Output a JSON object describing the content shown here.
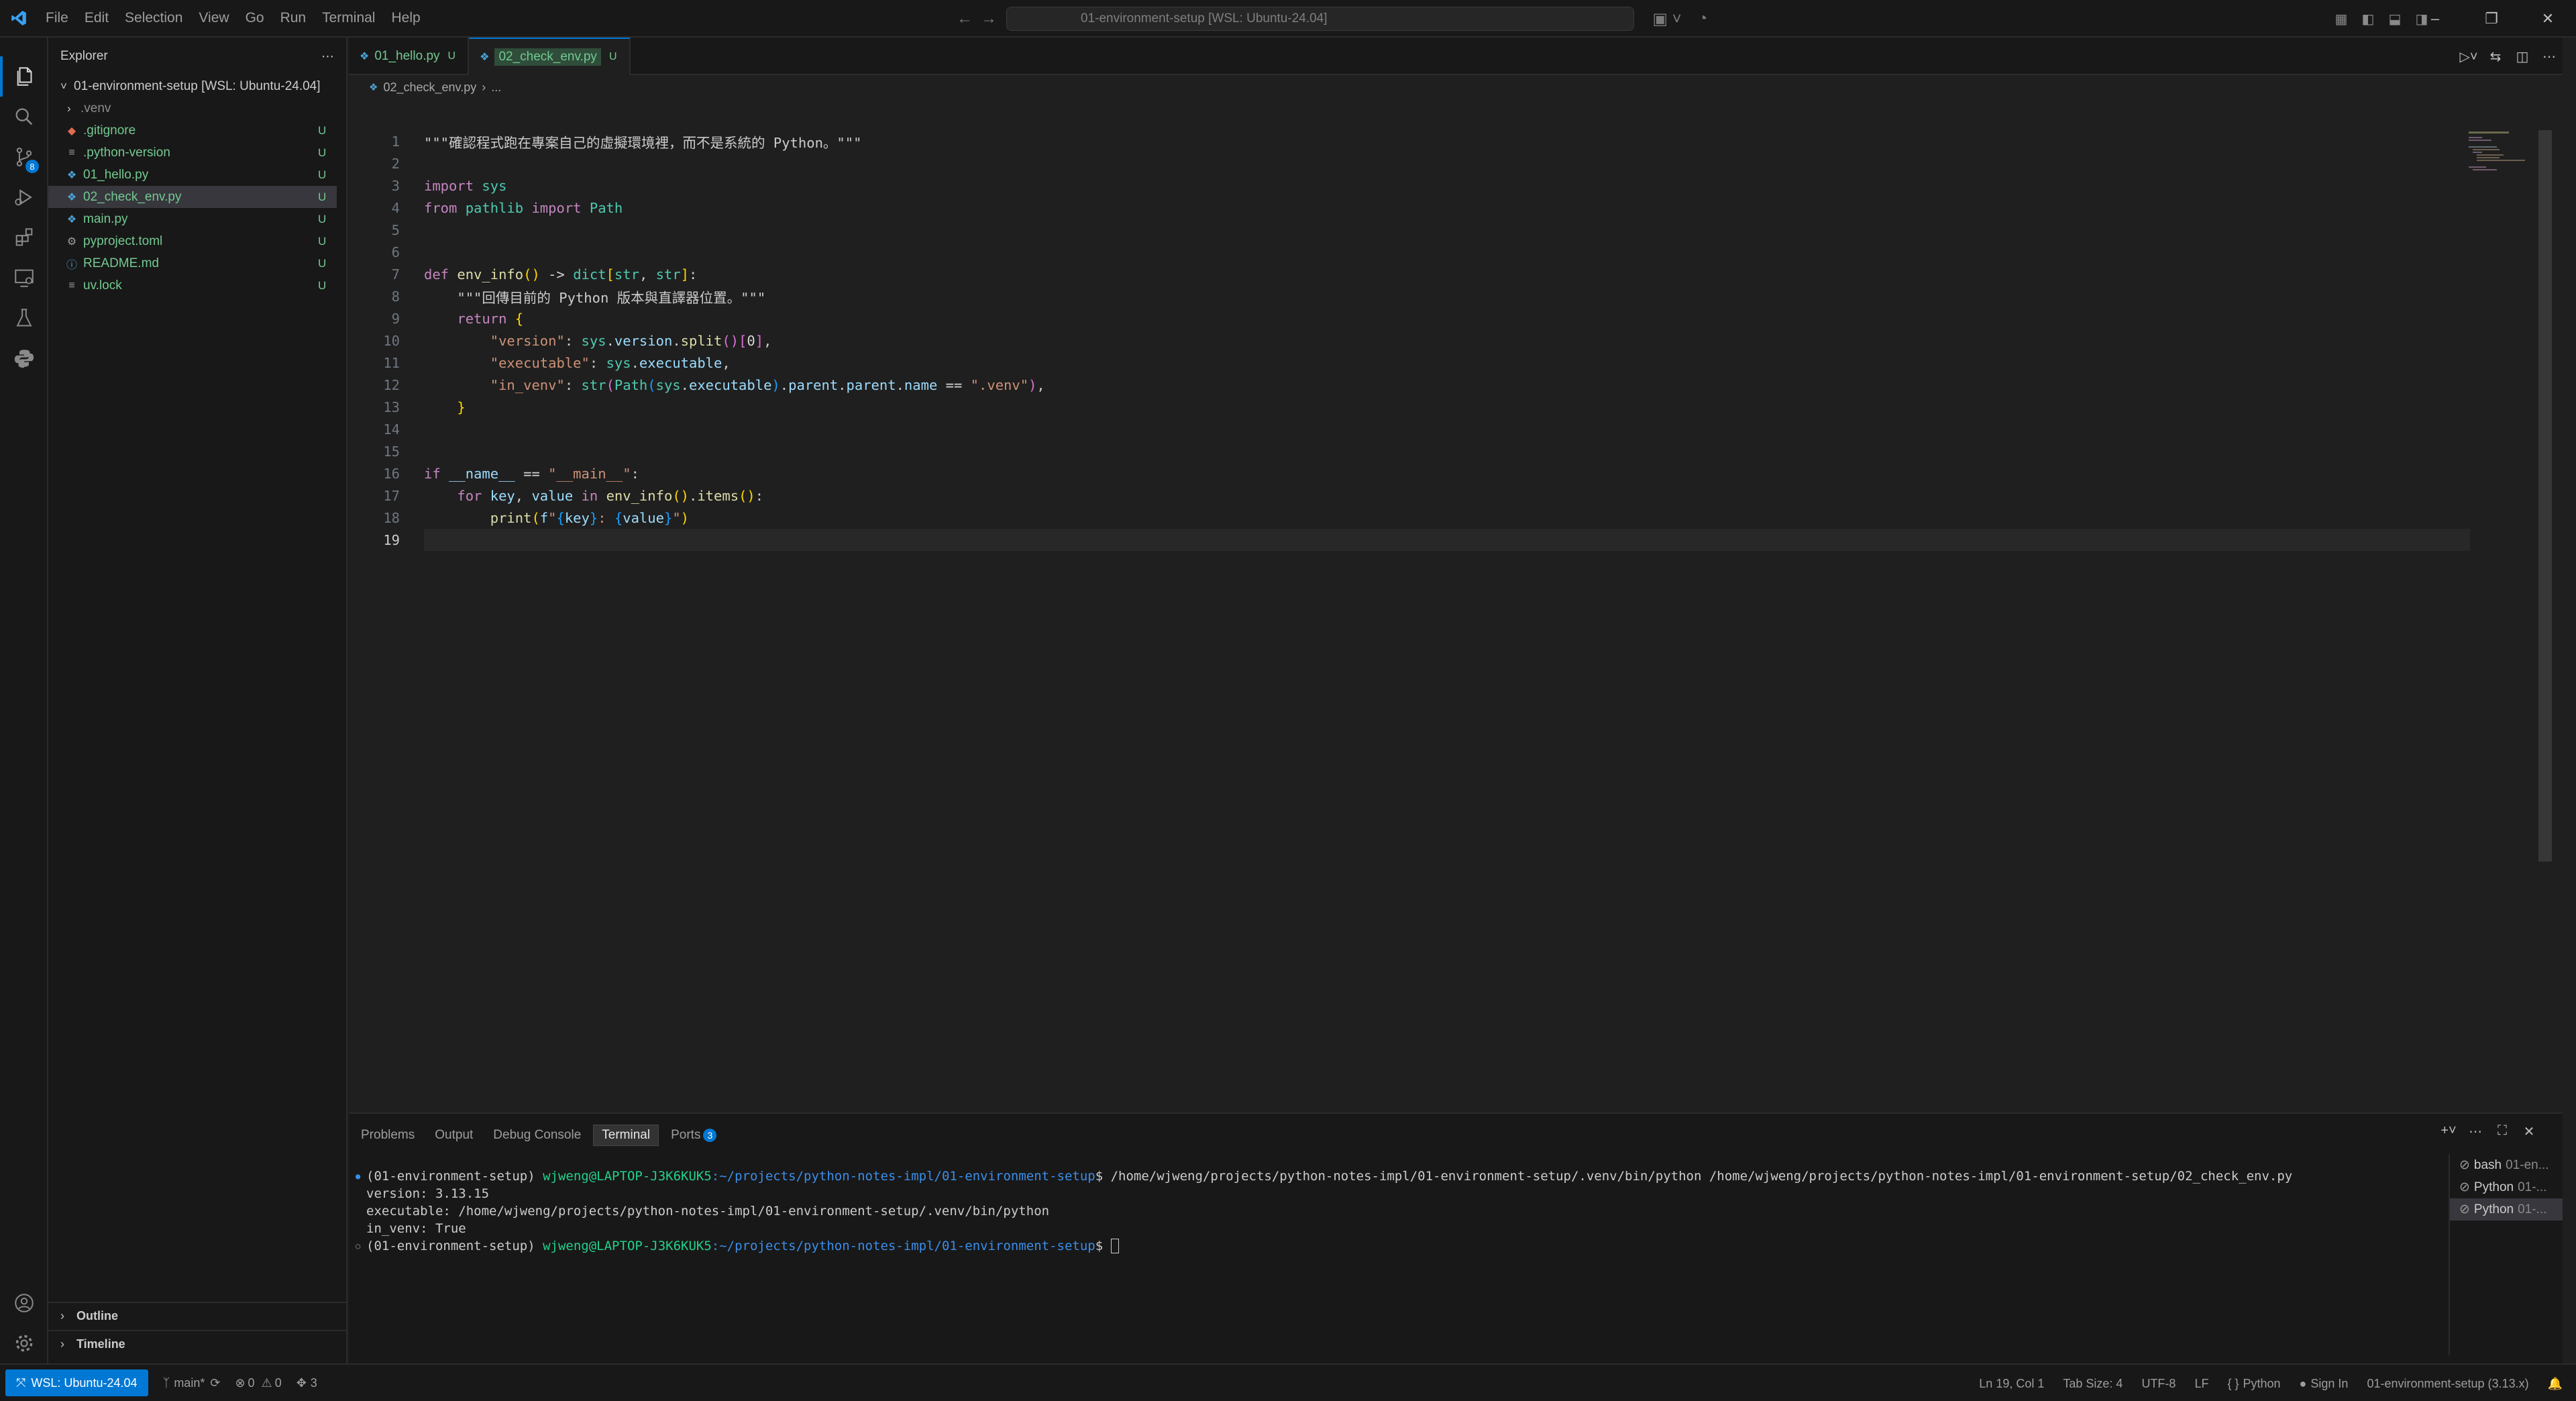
{
  "titlebar": {
    "menu": [
      "File",
      "Edit",
      "Selection",
      "View",
      "Go",
      "Run",
      "Terminal",
      "Help"
    ],
    "command_center": "01-environment-setup [WSL: Ubuntu-24.04]"
  },
  "activity": {
    "scm_badge": "8"
  },
  "sidebar": {
    "title": "Explorer",
    "root": "01-environment-setup [WSL: Ubuntu-24.04]",
    "items": [
      {
        "label": ".venv",
        "status": "",
        "icon": "folder"
      },
      {
        "label": ".gitignore",
        "status": "U",
        "icon": "git"
      },
      {
        "label": ".python-version",
        "status": "U",
        "icon": "lines"
      },
      {
        "label": "01_hello.py",
        "status": "U",
        "icon": "python"
      },
      {
        "label": "02_check_env.py",
        "status": "U",
        "icon": "python"
      },
      {
        "label": "main.py",
        "status": "U",
        "icon": "python"
      },
      {
        "label": "pyproject.toml",
        "status": "U",
        "icon": "gear"
      },
      {
        "label": "README.md",
        "status": "U",
        "icon": "info"
      },
      {
        "label": "uv.lock",
        "status": "U",
        "icon": "lines"
      }
    ],
    "outline": "Outline",
    "timeline": "Timeline"
  },
  "editor": {
    "tabs": [
      {
        "label": "01_hello.py",
        "status": "U"
      },
      {
        "label": "02_check_env.py",
        "status": "U"
      }
    ],
    "breadcrumb": "02_check_env.py",
    "breadcrumb_more": "...",
    "line_numbers": [
      "1",
      "2",
      "3",
      "4",
      "5",
      "6",
      "7",
      "8",
      "9",
      "10",
      "11",
      "12",
      "13",
      "14",
      "15",
      "16",
      "17",
      "18",
      "19"
    ]
  },
  "panel": {
    "tabs": [
      "Problems",
      "Output",
      "Debug Console",
      "Terminal",
      "Ports"
    ],
    "ports_count": "3",
    "terminal": {
      "line1_env": "(01-environment-setup) ",
      "line1_user": "wjweng@LAPTOP-J3K6KUK5",
      "line1_path": ":~/projects/python-notes-impl/01-environment-setup",
      "line1_cmd": "$ /home/wjweng/projects/python-notes-impl/01-environment-setup/.venv/bin/python /home/wjweng/projects/python-notes-impl/01-environment-setup/02_check_env.py",
      "out1": "version: 3.13.15",
      "out2": "executable: /home/wjweng/projects/python-notes-impl/01-environment-setup/.venv/bin/python",
      "out3": "in_venv: True",
      "line5_env": "(01-environment-setup) ",
      "line5_user": "wjweng@LAPTOP-J3K6KUK5",
      "line5_path": ":~/projects/python-notes-impl/01-environment-setup",
      "line5_prompt": "$ "
    },
    "terminals": [
      {
        "name": "bash",
        "sub": "01-en..."
      },
      {
        "name": "Python",
        "sub": "01-..."
      },
      {
        "name": "Python",
        "sub": "01-..."
      }
    ]
  },
  "statusbar": {
    "remote": "WSL: Ubuntu-24.04",
    "branch": "main*",
    "errors": "0",
    "warnings": "0",
    "ports": "3",
    "position": "Ln 19, Col 1",
    "tab_size": "Tab Size: 4",
    "encoding": "UTF-8",
    "eol": "LF",
    "language": "Python",
    "sign_in": "Sign In",
    "interpreter": "01-environment-setup (3.13.x)"
  },
  "colors": {
    "accent": "#0078d4",
    "untracked": "#73c991"
  }
}
